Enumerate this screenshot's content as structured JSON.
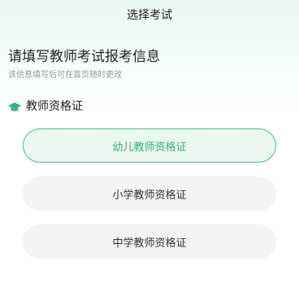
{
  "header": {
    "title": "选择考试"
  },
  "intro": {
    "heading": "请填写教师考试报考信息",
    "subheading": "该信息填写后可在首页随时更改"
  },
  "section": {
    "icon": "graduation-cap-icon",
    "title": "教师资格证"
  },
  "options": [
    {
      "label": "幼儿教师资格证",
      "selected": true
    },
    {
      "label": "小学教师资格证",
      "selected": false
    },
    {
      "label": "中学教师资格证",
      "selected": false
    }
  ],
  "colors": {
    "accent": "#3fc18a",
    "accent_text": "#2fb47c",
    "selected_bg": "#eaf8f1",
    "option_bg": "#f4f4f4"
  }
}
